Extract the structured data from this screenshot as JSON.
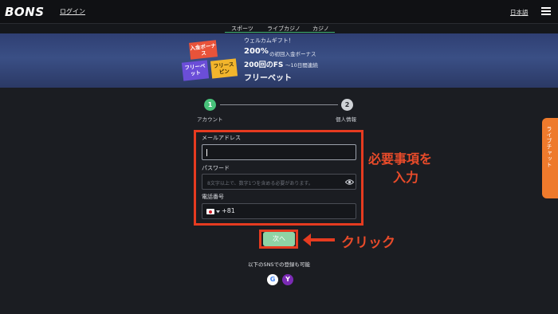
{
  "header": {
    "logo": "BONS",
    "login": "ログイン",
    "language": "日本語"
  },
  "tabs": [
    "スポーツ",
    "ライブカジノ",
    "カジノ"
  ],
  "banner": {
    "gifts": [
      "入金ボーナス",
      "フリーベット",
      "フリースピン"
    ],
    "lines": [
      {
        "main": "ウェルカムギフト！",
        "sub": ""
      },
      {
        "main": "200%",
        "sub": "の初回入金ボーナス"
      },
      {
        "main": "200回のFS",
        "sub": "〜10日間連続"
      },
      {
        "main": "フリーベット",
        "sub": ""
      }
    ]
  },
  "steps": [
    {
      "number": "1",
      "label": "アカウント",
      "active": true
    },
    {
      "number": "2",
      "label": "個人情報",
      "active": false
    }
  ],
  "form": {
    "email_label": "メールアドレス",
    "email_value": "",
    "password_label": "パスワード",
    "password_placeholder": "8文字以上で、数字1つを含める必要があります。",
    "phone_label": "電話番号",
    "phone_country_code": "+81",
    "next_button": "次へ"
  },
  "annotations": {
    "required_note_line1": "必要事項を",
    "required_note_line2": "入力",
    "click_note": "クリック"
  },
  "sns": {
    "text": "以下のSNSでの登録も可能",
    "google": "G",
    "yahoo": "Y"
  },
  "live_chat": "ライブチャット",
  "colors": {
    "accent_green": "#3fb37a",
    "annotation_red": "#e63b20",
    "chat_orange": "#ee7a2c"
  }
}
